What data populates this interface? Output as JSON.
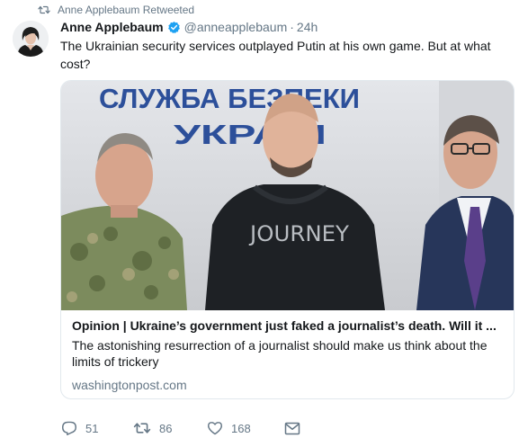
{
  "context": {
    "text": "Anne Applebaum Retweeted",
    "icon": "retweet-icon"
  },
  "author": {
    "name": "Anne Applebaum",
    "handle": "@anneapplebaum",
    "separator": "·",
    "time": "24h",
    "verified": true
  },
  "tweet_text": "The Ukrainian security services outplayed Putin at his own game. But at what cost?",
  "card": {
    "image_sign_line1": "СЛУЖБА БЕЗПЕКИ",
    "image_sign_line2": "УКРАЇН",
    "image_shirt_text": "JOURNEY",
    "title": "Opinion | Ukraine’s government just faked a journalist’s death. Will it ...",
    "description": "The astonishing resurrection of a journalist should make us think about the limits of trickery",
    "domain": "washingtonpost.com"
  },
  "actions": {
    "replies": "51",
    "retweets": "86",
    "likes": "168"
  },
  "colors": {
    "text": "#14171a",
    "secondary": "#657786",
    "verified_blue": "#1da1f2",
    "border": "#e1e8ed"
  }
}
